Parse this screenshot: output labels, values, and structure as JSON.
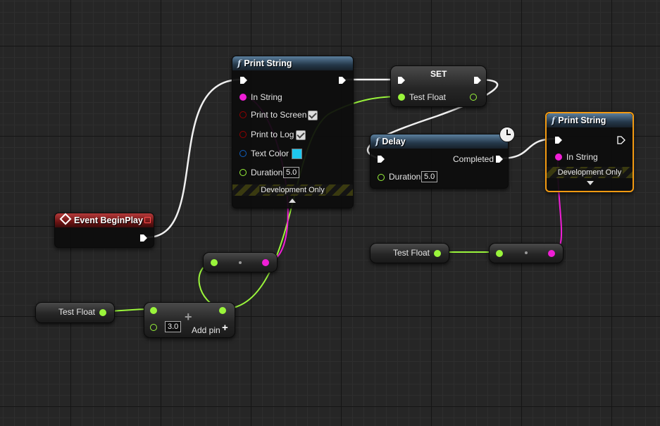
{
  "colors": {
    "exec": "#ffffff",
    "string": "#f01ed6",
    "float": "#9af53b",
    "bool": "#940000",
    "struct": "#1060c0",
    "select_border": "#f39a11",
    "swatch": "#1ec8f0"
  },
  "nodes": {
    "print_string_1": {
      "title": "Print String",
      "in_string": "In String",
      "print_to_screen": "Print to Screen",
      "print_to_log": "Print to Log",
      "text_color": "Text Color",
      "duration": "Duration",
      "duration_value": "5.0",
      "dev_only": "Development Only"
    },
    "set": {
      "title": "SET",
      "var": "Test Float"
    },
    "delay": {
      "title": "Delay",
      "completed": "Completed",
      "duration": "Duration",
      "duration_value": "5.0"
    },
    "print_string_2": {
      "title": "Print String",
      "in_string": "In String",
      "dev_only": "Development Only"
    },
    "event_begin_play": {
      "title": "Event BeginPlay"
    },
    "get_test_float_1": {
      "label": "Test Float"
    },
    "get_test_float_2": {
      "label": "Test Float"
    },
    "add": {
      "value": "3.0",
      "add_pin": "Add pin"
    }
  }
}
